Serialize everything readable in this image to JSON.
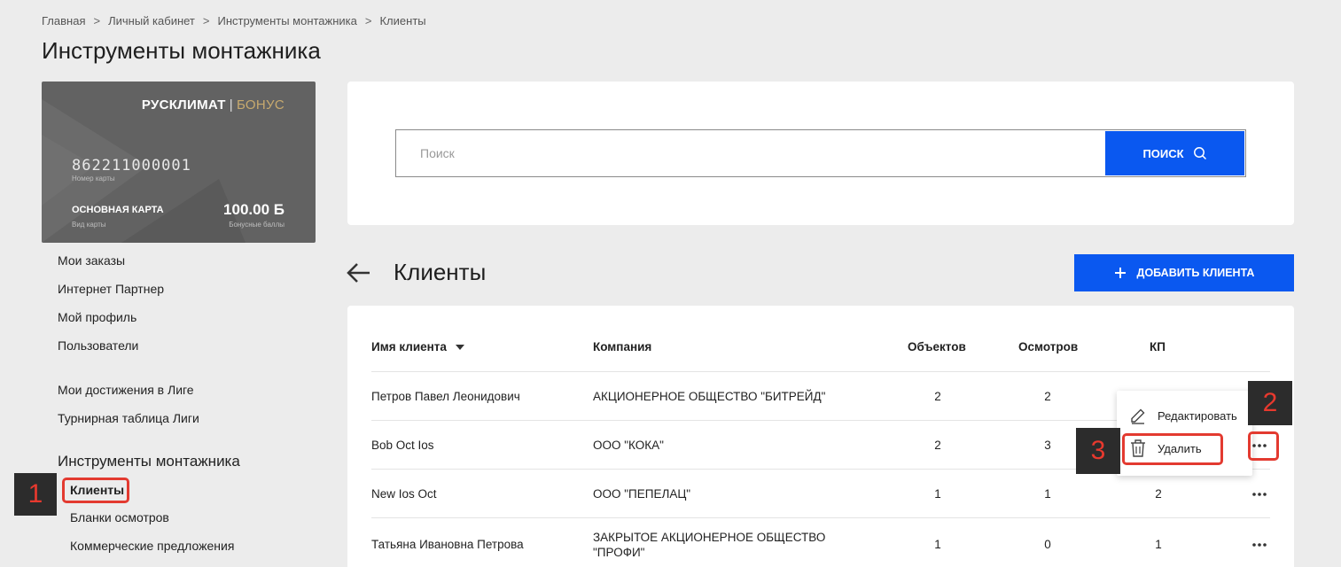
{
  "breadcrumb": {
    "items": [
      "Главная",
      "Личный кабинет",
      "Инструменты монтажника",
      "Клиенты"
    ],
    "separator": ">"
  },
  "page_title": "Инструменты монтажника",
  "card": {
    "brand": "РУСКЛИМАТ",
    "brand_suffix": "БОНУС",
    "brand_pipe": "|",
    "number": "862211000001",
    "number_label": "Номер карты",
    "type": "ОСНОВНАЯ КАРТА",
    "type_label": "Вид карты",
    "balance": "100.00 Б",
    "balance_label": "Бонусные баллы"
  },
  "sidebar": {
    "items": [
      "Мои заказы",
      "Интернет Партнер",
      "Мой профиль",
      "Пользователи",
      "Мои достижения в Лиге",
      "Турнирная таблица Лиги"
    ],
    "section_title": "Инструменты монтажника",
    "subitems": [
      "Клиенты",
      "Бланки осмотров",
      "Коммерческие предложения"
    ]
  },
  "search": {
    "placeholder": "Поиск",
    "button_label": "ПОИСК"
  },
  "clients": {
    "title": "Клиенты",
    "add_button_label": "ДОБАВИТЬ КЛИЕНТА"
  },
  "table": {
    "columns": [
      "Имя клиента",
      "Компания",
      "Объектов",
      "Осмотров",
      "КП"
    ],
    "rows": [
      {
        "name": "Петров Павел Леонидович",
        "company": "АКЦИОНЕРНОЕ ОБЩЕСТВО \"БИТРЕЙД\"",
        "company2": "",
        "objects": "2",
        "inspections": "2",
        "kp": ""
      },
      {
        "name": "Bob Oct Ios",
        "company": "ООО \"КОКА\"",
        "company2": "",
        "objects": "2",
        "inspections": "3",
        "kp": ""
      },
      {
        "name": "New Ios Oct",
        "company": "ООО \"ПЕПЕЛАЦ\"",
        "company2": "",
        "objects": "1",
        "inspections": "1",
        "kp": "2"
      },
      {
        "name": "Татьяна Ивановна Петрова",
        "company": "ЗАКРЫТОЕ АКЦИОНЕРНОЕ ОБЩЕСТВО",
        "company2": "\"ПРОФИ\"",
        "objects": "1",
        "inspections": "0",
        "kp": "1"
      }
    ]
  },
  "context_menu": {
    "edit_label": "Редактировать",
    "delete_label": "Удалить"
  },
  "annotations": {
    "step1": "1",
    "step2": "2",
    "step3": "3",
    "color": "#e33a30"
  },
  "colors": {
    "accent": "#0a58f0",
    "background": "#ececec",
    "card": "#626262",
    "card_bonus": "#c8aa6e"
  }
}
